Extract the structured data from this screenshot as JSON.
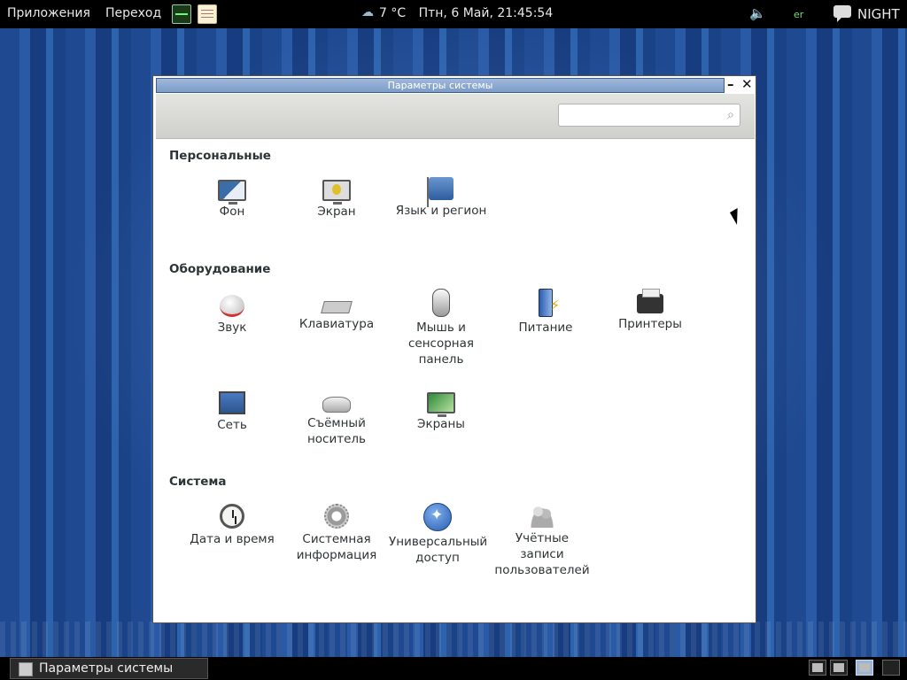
{
  "top_panel": {
    "applications": "Приложения",
    "places": "Переход",
    "weather": "7 °C",
    "datetime": "Птн,  6 Май, 21:45:54",
    "keyboard_layout": "er",
    "user": "NIGHT"
  },
  "window": {
    "title": "Параметры системы",
    "search_placeholder": ""
  },
  "sections": {
    "personal": {
      "title": "Персональные",
      "items": [
        "Фон",
        "Экран",
        "Язык и регион"
      ]
    },
    "hardware": {
      "title": "Оборудование",
      "items": [
        "Звук",
        "Клавиатура",
        "Мышь и сенсорная панель",
        "Питание",
        "Принтеры",
        "Сеть",
        "Съёмный носитель",
        "Экраны"
      ]
    },
    "system": {
      "title": "Система",
      "items": [
        "Дата и время",
        "Системная информация",
        "Универсальный доступ",
        "Учётные записи пользователей"
      ]
    }
  },
  "taskbar": {
    "window_label": "Параметры системы"
  }
}
